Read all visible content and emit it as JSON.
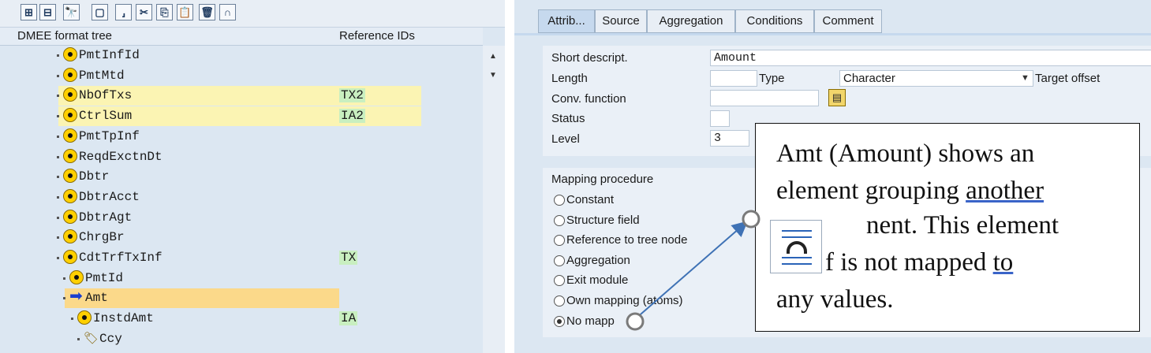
{
  "toolbar": {
    "buttons": [
      {
        "icon": "expand-icon",
        "glyph": "⊞"
      },
      {
        "icon": "collapse-icon",
        "glyph": "⊟"
      },
      {
        "icon": "find-icon",
        "glyph": "🔭"
      },
      {
        "icon": "new-node-icon",
        "glyph": "▢"
      },
      {
        "icon": "insert-icon",
        "glyph": "⸥"
      },
      {
        "icon": "cut-icon",
        "glyph": "✂"
      },
      {
        "icon": "copy-icon",
        "glyph": "⎘"
      },
      {
        "icon": "paste-icon",
        "glyph": "📋"
      },
      {
        "icon": "delete-icon",
        "glyph": "🗑"
      },
      {
        "icon": "undo-icon",
        "glyph": "∩"
      }
    ]
  },
  "tree": {
    "col_tree": "DMEE format tree",
    "col_ref": "Reference IDs",
    "rows": [
      {
        "name": "PmtInfId",
        "ref": "",
        "level": 1,
        "highlight": false,
        "icon": "node"
      },
      {
        "name": "PmtMtd",
        "ref": "",
        "level": 1,
        "highlight": false,
        "icon": "node"
      },
      {
        "name": "NbOfTxs",
        "ref": "TX2",
        "level": 1,
        "highlight": true,
        "icon": "node"
      },
      {
        "name": "CtrlSum",
        "ref": "IA2",
        "level": 1,
        "highlight": true,
        "icon": "node"
      },
      {
        "name": "PmtTpInf",
        "ref": "",
        "level": 1,
        "highlight": false,
        "icon": "node"
      },
      {
        "name": "ReqdExctnDt",
        "ref": "",
        "level": 1,
        "highlight": false,
        "icon": "node"
      },
      {
        "name": "Dbtr",
        "ref": "",
        "level": 1,
        "highlight": false,
        "icon": "node"
      },
      {
        "name": "DbtrAcct",
        "ref": "",
        "level": 1,
        "highlight": false,
        "icon": "node"
      },
      {
        "name": "DbtrAgt",
        "ref": "",
        "level": 1,
        "highlight": false,
        "icon": "node"
      },
      {
        "name": "ChrgBr",
        "ref": "",
        "level": 1,
        "highlight": false,
        "icon": "node"
      },
      {
        "name": "CdtTrfTxInf",
        "ref": "TX",
        "level": 1,
        "highlight": false,
        "icon": "node"
      },
      {
        "name": "PmtId",
        "ref": "",
        "level": 2,
        "highlight": false,
        "icon": "node"
      },
      {
        "name": "Amt",
        "ref": "",
        "level": 2,
        "highlight": "selected",
        "icon": "arrow"
      },
      {
        "name": "InstdAmt",
        "ref": "IA",
        "level": 3,
        "highlight": false,
        "icon": "node"
      },
      {
        "name": "Ccy",
        "ref": "",
        "level": 4,
        "highlight": false,
        "icon": "tag"
      }
    ]
  },
  "tabs": [
    {
      "label": "Attrib...",
      "active": true
    },
    {
      "label": "Source",
      "active": false
    },
    {
      "label": "Aggregation",
      "active": false
    },
    {
      "label": "Conditions",
      "active": false
    },
    {
      "label": "Comment",
      "active": false
    }
  ],
  "attributes": {
    "short_descript_label": "Short descript.",
    "short_descript_value": "Amount",
    "length_label": "Length",
    "length_value": "",
    "type_label": "Type",
    "type_value": "Character",
    "target_offset_label": "Target offset",
    "conv_function_label": "Conv. function",
    "conv_function_value": "",
    "status_label": "Status",
    "status_value": "",
    "level_label": "Level",
    "level_value": "3"
  },
  "mapping": {
    "title": "Mapping procedure",
    "options": [
      {
        "label": "Constant",
        "selected": false
      },
      {
        "label": "Structure field",
        "selected": false
      },
      {
        "label": "Reference to tree node",
        "selected": false
      },
      {
        "label": "Aggregation",
        "selected": false
      },
      {
        "label": "Exit module",
        "selected": false
      },
      {
        "label": "Own mapping (atoms)",
        "selected": false
      },
      {
        "label": "No mapp",
        "selected": true
      }
    ]
  },
  "callout": {
    "line1": "Amt (Amount) shows an",
    "line2_a": "element grouping ",
    "line2_b": "another",
    "line3": "nent. This element",
    "line4_a": "f is not mapped ",
    "line4_b": "to",
    "line5": "any values."
  },
  "colors": {
    "highlight": "#fbf4b3",
    "selected": "#fbd98a",
    "ref_bg": "#c9efc0",
    "connector": "#3f72b5"
  }
}
